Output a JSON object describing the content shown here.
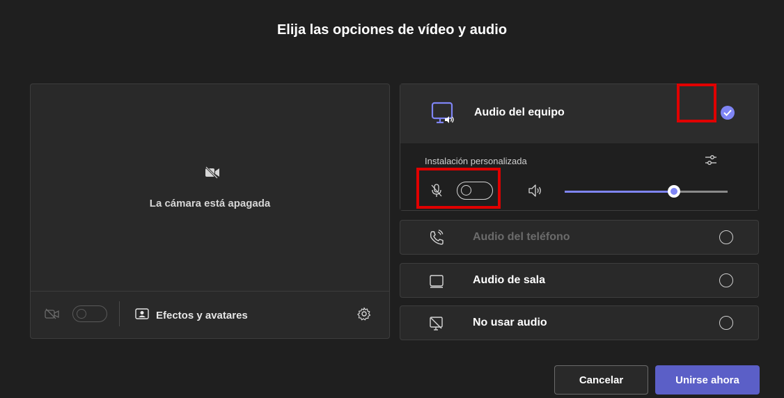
{
  "dialog": {
    "title": "Elija las opciones de vídeo y audio"
  },
  "camera": {
    "status_text": "La cámara está apagada",
    "effects_label": "Efectos y avatares",
    "video_toggle_on": false,
    "icons": [
      "video-off-icon",
      "effects-icon",
      "gear-icon"
    ]
  },
  "audio": {
    "pc_audio": {
      "label": "Audio del equipo",
      "selected": true,
      "custom_setup_label": "Instalación personalizada",
      "mic_toggle_on": false,
      "speaker_volume_fraction": 0.67,
      "icons": [
        "computer-audio-icon",
        "settings-sliders-icon",
        "mic-off-icon",
        "speaker-icon",
        "check-icon"
      ]
    },
    "phone_audio": {
      "label": "Audio del teléfono",
      "selected": false,
      "disabled": true
    },
    "room_audio": {
      "label": "Audio de sala",
      "selected": false
    },
    "no_audio": {
      "label": "No usar audio",
      "selected": false
    }
  },
  "buttons": {
    "cancel": "Cancelar",
    "join": "Unirse ahora"
  },
  "colors": {
    "accent": "#7f85f5",
    "join_button": "#5b5fc7",
    "highlight": "#e00000",
    "background": "#1f1f1f"
  }
}
